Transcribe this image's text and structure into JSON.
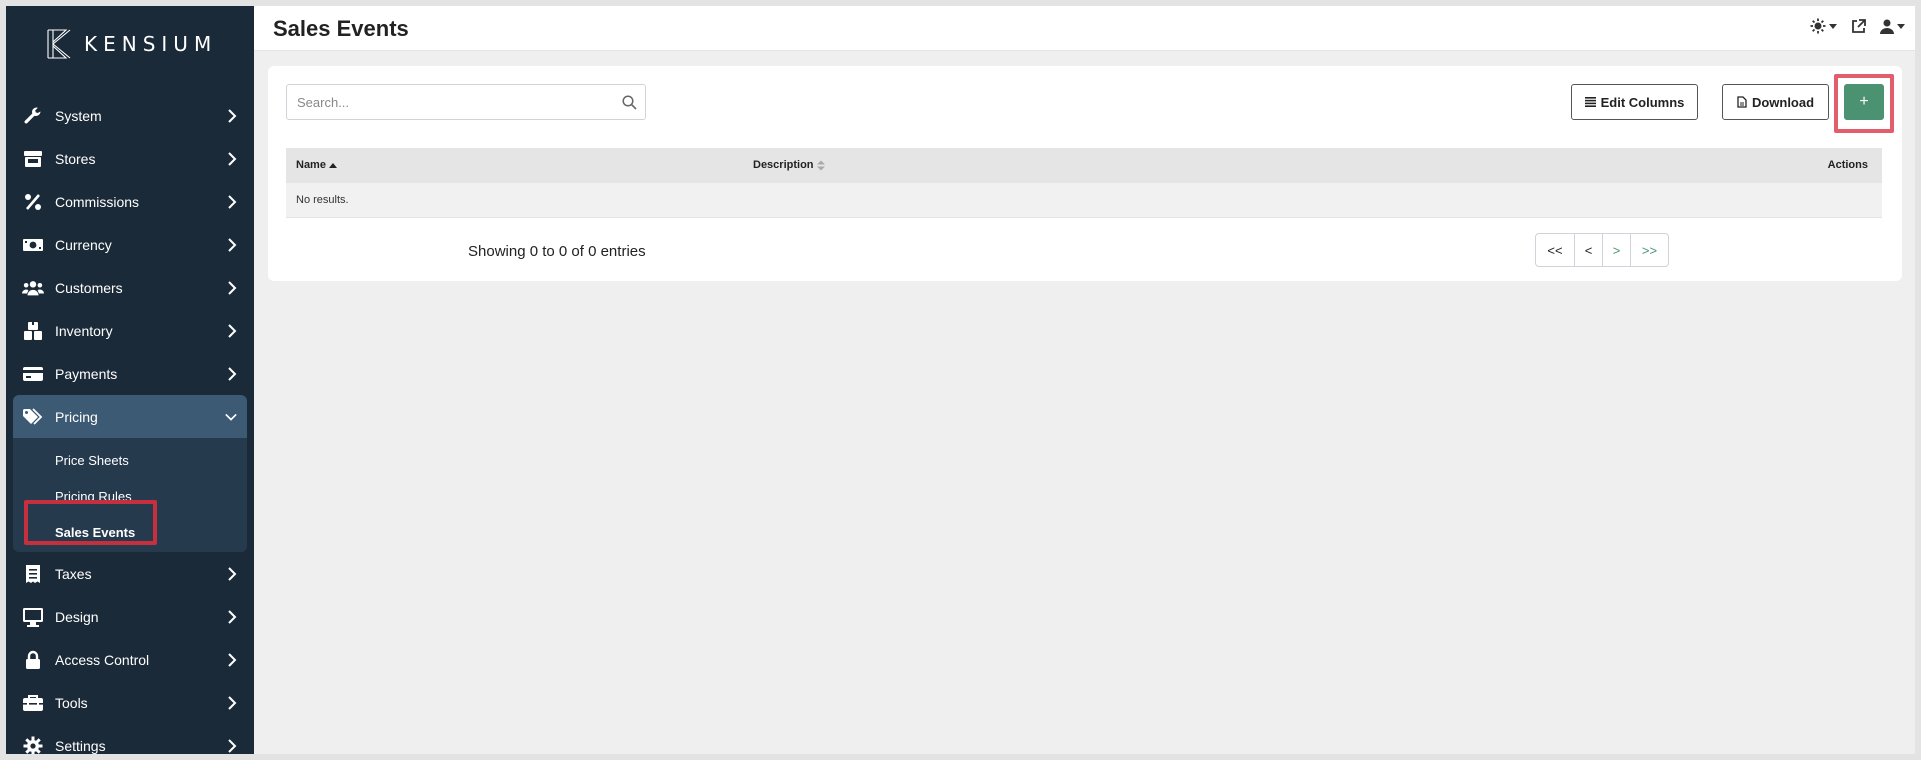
{
  "brand": {
    "name": "KENSIUM"
  },
  "header": {
    "title": "Sales Events"
  },
  "sidebar": {
    "items": [
      {
        "label": "System",
        "icon": "wrench-icon"
      },
      {
        "label": "Stores",
        "icon": "store-icon"
      },
      {
        "label": "Commissions",
        "icon": "percent-icon"
      },
      {
        "label": "Currency",
        "icon": "money-bill-icon"
      },
      {
        "label": "Customers",
        "icon": "users-icon"
      },
      {
        "label": "Inventory",
        "icon": "boxes-icon"
      },
      {
        "label": "Payments",
        "icon": "credit-card-icon"
      },
      {
        "label": "Pricing",
        "icon": "tags-icon",
        "expanded": true
      },
      {
        "label": "Taxes",
        "icon": "receipt-icon"
      },
      {
        "label": "Design",
        "icon": "desktop-icon"
      },
      {
        "label": "Access Control",
        "icon": "lock-icon"
      },
      {
        "label": "Tools",
        "icon": "toolbox-icon"
      },
      {
        "label": "Settings",
        "icon": "gear-icon"
      }
    ],
    "pricing_sub": [
      {
        "label": "Price Sheets"
      },
      {
        "label": "Pricing Rules"
      },
      {
        "label": "Sales Events",
        "current": true
      }
    ]
  },
  "toolbar": {
    "search_placeholder": "Search...",
    "edit_columns_label": "Edit Columns",
    "download_label": "Download",
    "add_label": "+"
  },
  "table": {
    "columns": [
      "Name",
      "Description",
      "Actions"
    ],
    "empty_text": "No results."
  },
  "pagination": {
    "info": "Showing 0 to 0 of 0 entries",
    "first": "<<",
    "prev": "<",
    "next": ">",
    "last": ">>"
  },
  "colors": {
    "sidebar_bg": "#1b2a38",
    "active_bg": "#3d5a74",
    "accent_green": "#4b9272",
    "highlight_red": "#e35d6a"
  }
}
